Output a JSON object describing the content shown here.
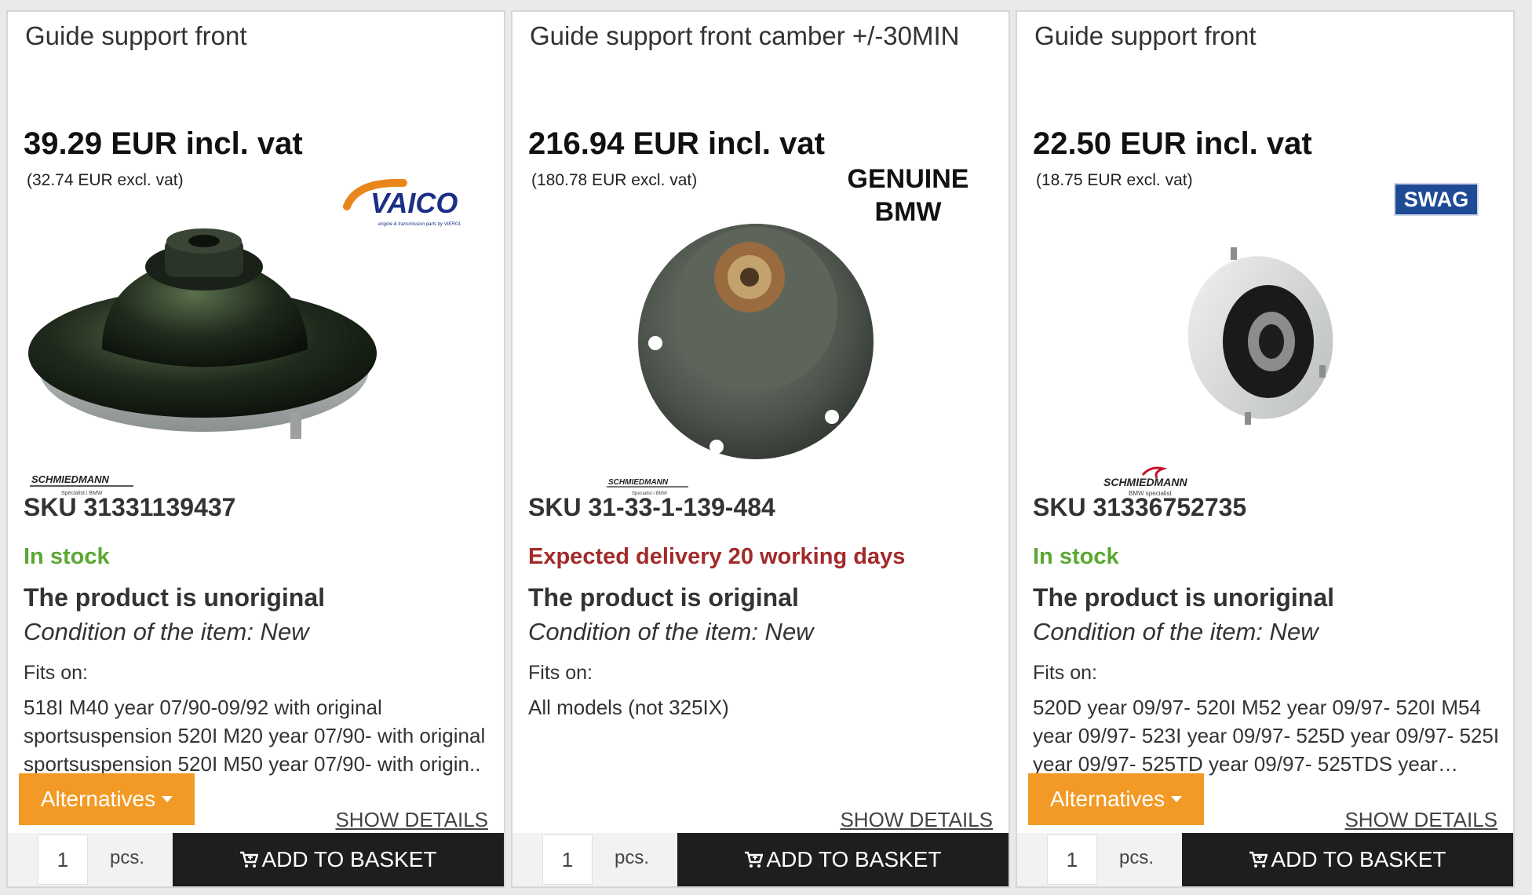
{
  "products": [
    {
      "title": "Guide support front",
      "price": "39.29 EUR incl. vat",
      "price_excl": "(32.74 EUR excl. vat)",
      "brand": "VAICO",
      "brand_tagline": "engine & transmission parts by VIEROL",
      "seller_logo": "SCHMIEDMANN",
      "seller_sub": "Specialist i BMW",
      "sku": "SKU  31331139437",
      "stock": "In stock",
      "stock_status": "in-stock",
      "originality": "The product is unoriginal",
      "condition": "Condition of the item: New",
      "fits_label": "Fits on:",
      "fits": "518I M40 year 07/90-09/92 with original sportsuspension 520I M20 year 07/90- with original sportsuspension 520I M50 year 07/90- with origin..",
      "alternatives_label": "Alternatives",
      "show_details": "SHOW DETAILS",
      "qty": "1",
      "pcs": "pcs.",
      "add_to_basket": "ADD TO BASKET"
    },
    {
      "title": "Guide support front camber +/-30MIN",
      "price": "216.94 EUR incl. vat",
      "price_excl": "(180.78 EUR excl. vat)",
      "brand": "GENUINE BMW",
      "brand_line1": "GENUINE",
      "brand_line2": "BMW",
      "seller_logo": "SCHMIEDMANN",
      "seller_sub": "Specialist i BMW",
      "sku": "SKU  31-33-1-139-484",
      "stock": "Expected delivery 20 working days",
      "stock_status": "delayed",
      "originality": "The product is original",
      "condition": "Condition of the item: New",
      "fits_label": "Fits on:",
      "fits": "All models (not 325IX)",
      "show_details": "SHOW DETAILS",
      "qty": "1",
      "pcs": "pcs.",
      "add_to_basket": "ADD TO BASKET"
    },
    {
      "title": "Guide support front",
      "price": "22.50 EUR incl. vat",
      "price_excl": "(18.75 EUR excl. vat)",
      "brand": "SWAG",
      "seller_logo": "SCHMIEDMANN",
      "seller_sub": "BMW specialist",
      "sku": "SKU  31336752735",
      "stock": "In stock",
      "stock_status": "in-stock",
      "originality": "The product is unoriginal",
      "condition": "Condition of the item: New",
      "fits_label": "Fits on:",
      "fits": "520D year 09/97- 520I M52 year 09/97- 520I M54 year 09/97- 523I year 09/97- 525D year 09/97- 525I year 09/97- 525TD year 09/97- 525TDS year…",
      "alternatives_label": "Alternatives",
      "show_details": "SHOW DETAILS",
      "qty": "1",
      "pcs": "pcs.",
      "add_to_basket": "ADD TO BASKET"
    }
  ],
  "colors": {
    "in_stock": "#5aa832",
    "delayed": "#a32a2a",
    "alternatives_button": "#f29a25",
    "basket_button": "#1d1e20",
    "vaico_orange": "#e8861b",
    "vaico_blue": "#1b2f86",
    "swag_blue": "#1f4b96",
    "schmiedmann_red": "#c8102e"
  },
  "icons": [
    "caret-down-icon",
    "cart-icon"
  ]
}
